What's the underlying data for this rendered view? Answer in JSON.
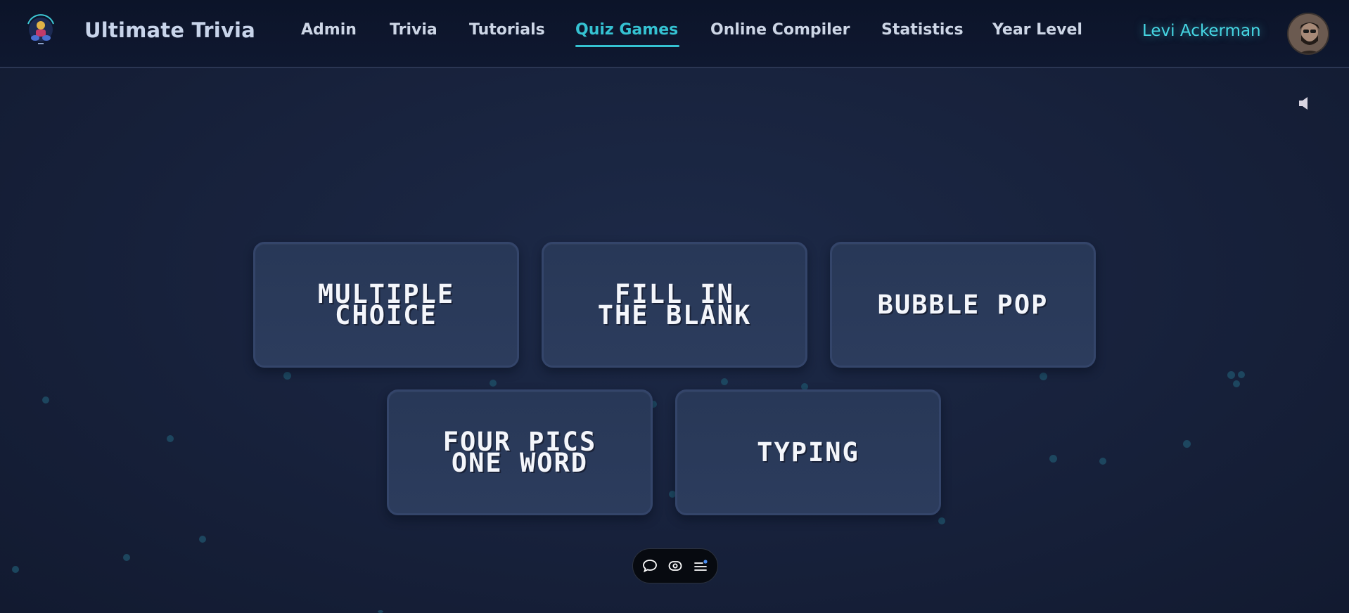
{
  "header": {
    "brand": "Ultimate Trivia",
    "logo_icon": "trivia-logo-icon",
    "nav": [
      {
        "label": "Admin"
      },
      {
        "label": "Trivia"
      },
      {
        "label": "Tutorials"
      },
      {
        "label": "Quiz Games",
        "active": true
      },
      {
        "label": "Online Compiler"
      },
      {
        "label": "Statistics"
      },
      {
        "label": "Year Level"
      }
    ],
    "user": {
      "name": "Levi Ackerman",
      "avatar_icon": "user-avatar"
    }
  },
  "sound_icon": "speaker-icon",
  "games": [
    {
      "label": "MULTIPLE\nCHOICE"
    },
    {
      "label": "FILL IN\nTHE BLANK"
    },
    {
      "label": "BUBBLE POP"
    },
    {
      "label": "FOUR PICS\nONE WORD"
    },
    {
      "label": "TYPING"
    }
  ],
  "floating_toolbar": {
    "buttons": [
      "chat-bubble-icon",
      "eye-icon",
      "menu-list-icon"
    ]
  },
  "colors": {
    "accent": "#35c2d2",
    "background": "#17213b",
    "card": "#2a3a5a",
    "header": "#0d152b"
  }
}
